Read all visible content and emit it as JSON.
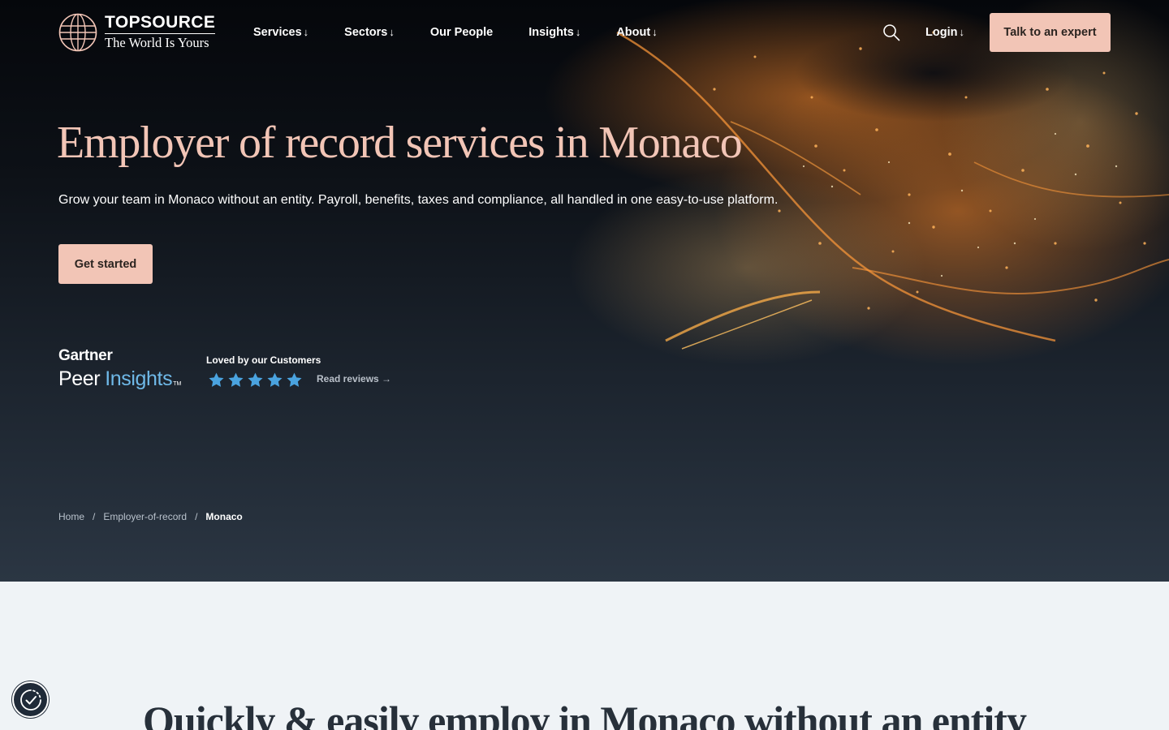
{
  "brand": {
    "name": "TOPSOURCE",
    "tagline": "The World Is Yours"
  },
  "nav": {
    "items": [
      {
        "label": "Services",
        "dropdown": true
      },
      {
        "label": "Sectors",
        "dropdown": true
      },
      {
        "label": "Our People",
        "dropdown": false
      },
      {
        "label": "Insights",
        "dropdown": true
      },
      {
        "label": "About",
        "dropdown": true
      }
    ],
    "login_label": "Login",
    "cta_label": "Talk to an expert",
    "dropdown_glyph": "↓"
  },
  "hero": {
    "title": "Employer of record services in Monaco",
    "subtitle": "Grow your team in Monaco without an entity. Payroll, benefits, taxes and compliance, all handled in one easy-to-use platform.",
    "cta_label": "Get started"
  },
  "reviews": {
    "provider_name": "Gartner",
    "provider_product_a": "Peer",
    "provider_product_b": "Insights",
    "provider_tm": "TM",
    "headline": "Loved by our Customers",
    "rating": 5,
    "rating_max": 5,
    "link_label": "Read reviews →"
  },
  "breadcrumb": {
    "items": [
      "Home",
      "Employer-of-record"
    ],
    "current": "Monaco",
    "separator": "/"
  },
  "section": {
    "heading": "Quickly & easily employ in Monaco without an entity"
  },
  "colors": {
    "accent": "#f2c5b6",
    "star": "#4aa3df",
    "hero_top": "#05070b",
    "hero_bottom": "#2b3643",
    "section_bg": "#eff3f6",
    "heading_dark": "#27303a"
  },
  "icons": {
    "logo": "globe-icon",
    "search": "search-icon",
    "consent": "cookie-consent-icon",
    "star": "star-icon"
  }
}
